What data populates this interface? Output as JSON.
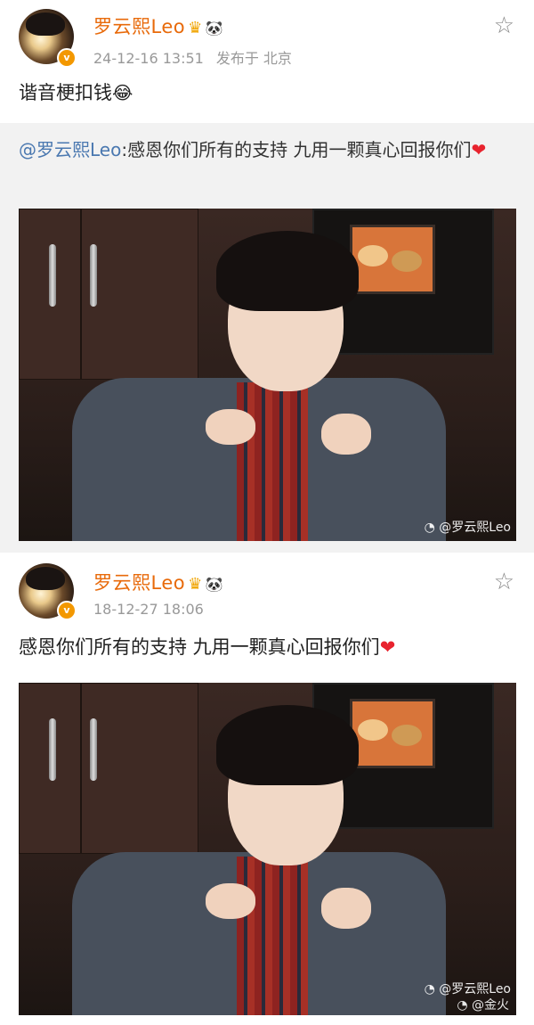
{
  "post1": {
    "username": "罗云熙Leo",
    "time": "24-12-16 13:51",
    "source": "发布于 北京",
    "text": "谐音梗扣钱",
    "repost": {
      "mention": "@罗云熙Leo",
      "text": ":感恩你们所有的支持 九用一颗真心回报你们"
    },
    "photo_watermark": "@罗云熙Leo"
  },
  "post2": {
    "username": "罗云熙Leo",
    "time": "18-12-27 18:06",
    "text": "感恩你们所有的支持 九用一颗真心回报你们",
    "photo_watermark": "@罗云熙Leo",
    "bottom_watermark": "@金火"
  },
  "icons": {
    "verified": "verified-badge",
    "crown": "crown-icon",
    "panda": "panda-icon",
    "star": "star-icon",
    "laugh": "laughing-emoji",
    "heart": "heart-emoji"
  },
  "colors": {
    "username": "#e86a0a",
    "mention": "#4a78b0",
    "heart": "#e8232e"
  }
}
